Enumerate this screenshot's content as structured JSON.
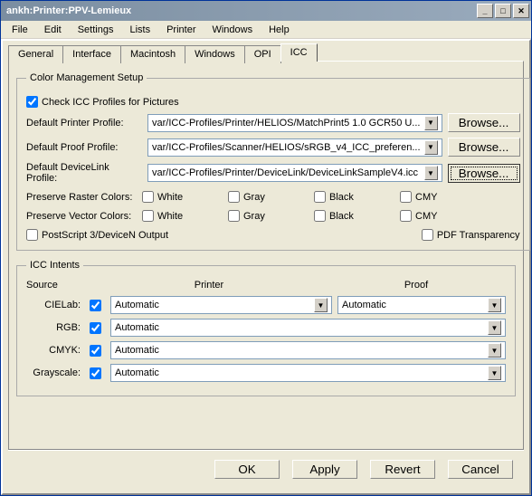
{
  "window": {
    "title": "ankh:Printer:PPV-Lemieux"
  },
  "menu": [
    "File",
    "Edit",
    "Settings",
    "Lists",
    "Printer",
    "Windows",
    "Help"
  ],
  "tabs": [
    "General",
    "Interface",
    "Macintosh",
    "Windows",
    "OPI",
    "ICC"
  ],
  "activeTab": "ICC",
  "cms": {
    "legend": "Color Management Setup",
    "checkLabel": "Check ICC Profiles for Pictures",
    "checkValue": true,
    "printerProfileLabel": "Default Printer Profile:",
    "printerProfile": "var/ICC-Profiles/Printer/HELIOS/MatchPrint5 1.0 GCR50 U...",
    "proofProfileLabel": "Default Proof Profile:",
    "proofProfile": "var/ICC-Profiles/Scanner/HELIOS/sRGB_v4_ICC_preferen...",
    "deviceLinkLabel": "Default DeviceLink Profile:",
    "deviceLinkProfile": "var/ICC-Profiles/Printer/DeviceLink/DeviceLinkSampleV4.icc",
    "browseLabel": "Browse...",
    "rasterLabel": "Preserve Raster Colors:",
    "vectorLabel": "Preserve Vector Colors:",
    "colorOpts": [
      "White",
      "Gray",
      "Black",
      "CMY"
    ],
    "rasterValues": [
      false,
      false,
      false,
      false
    ],
    "vectorValues": [
      false,
      false,
      false,
      false
    ],
    "psLabel": "PostScript 3/DeviceN Output",
    "psValue": false,
    "pdfLabel": "PDF Transparency",
    "pdfValue": false
  },
  "intents": {
    "legend": "ICC Intents",
    "headSource": "Source",
    "headPrinter": "Printer",
    "headProof": "Proof",
    "rows": [
      {
        "name": "CIELab:",
        "on": true,
        "printer": "Automatic",
        "proof": "Automatic"
      },
      {
        "name": "RGB:",
        "on": true,
        "printer": "Automatic",
        "proof": ""
      },
      {
        "name": "CMYK:",
        "on": true,
        "printer": "Automatic",
        "proof": ""
      },
      {
        "name": "Grayscale:",
        "on": true,
        "printer": "Automatic",
        "proof": ""
      }
    ]
  },
  "buttons": {
    "ok": "OK",
    "apply": "Apply",
    "revert": "Revert",
    "cancel": "Cancel"
  }
}
